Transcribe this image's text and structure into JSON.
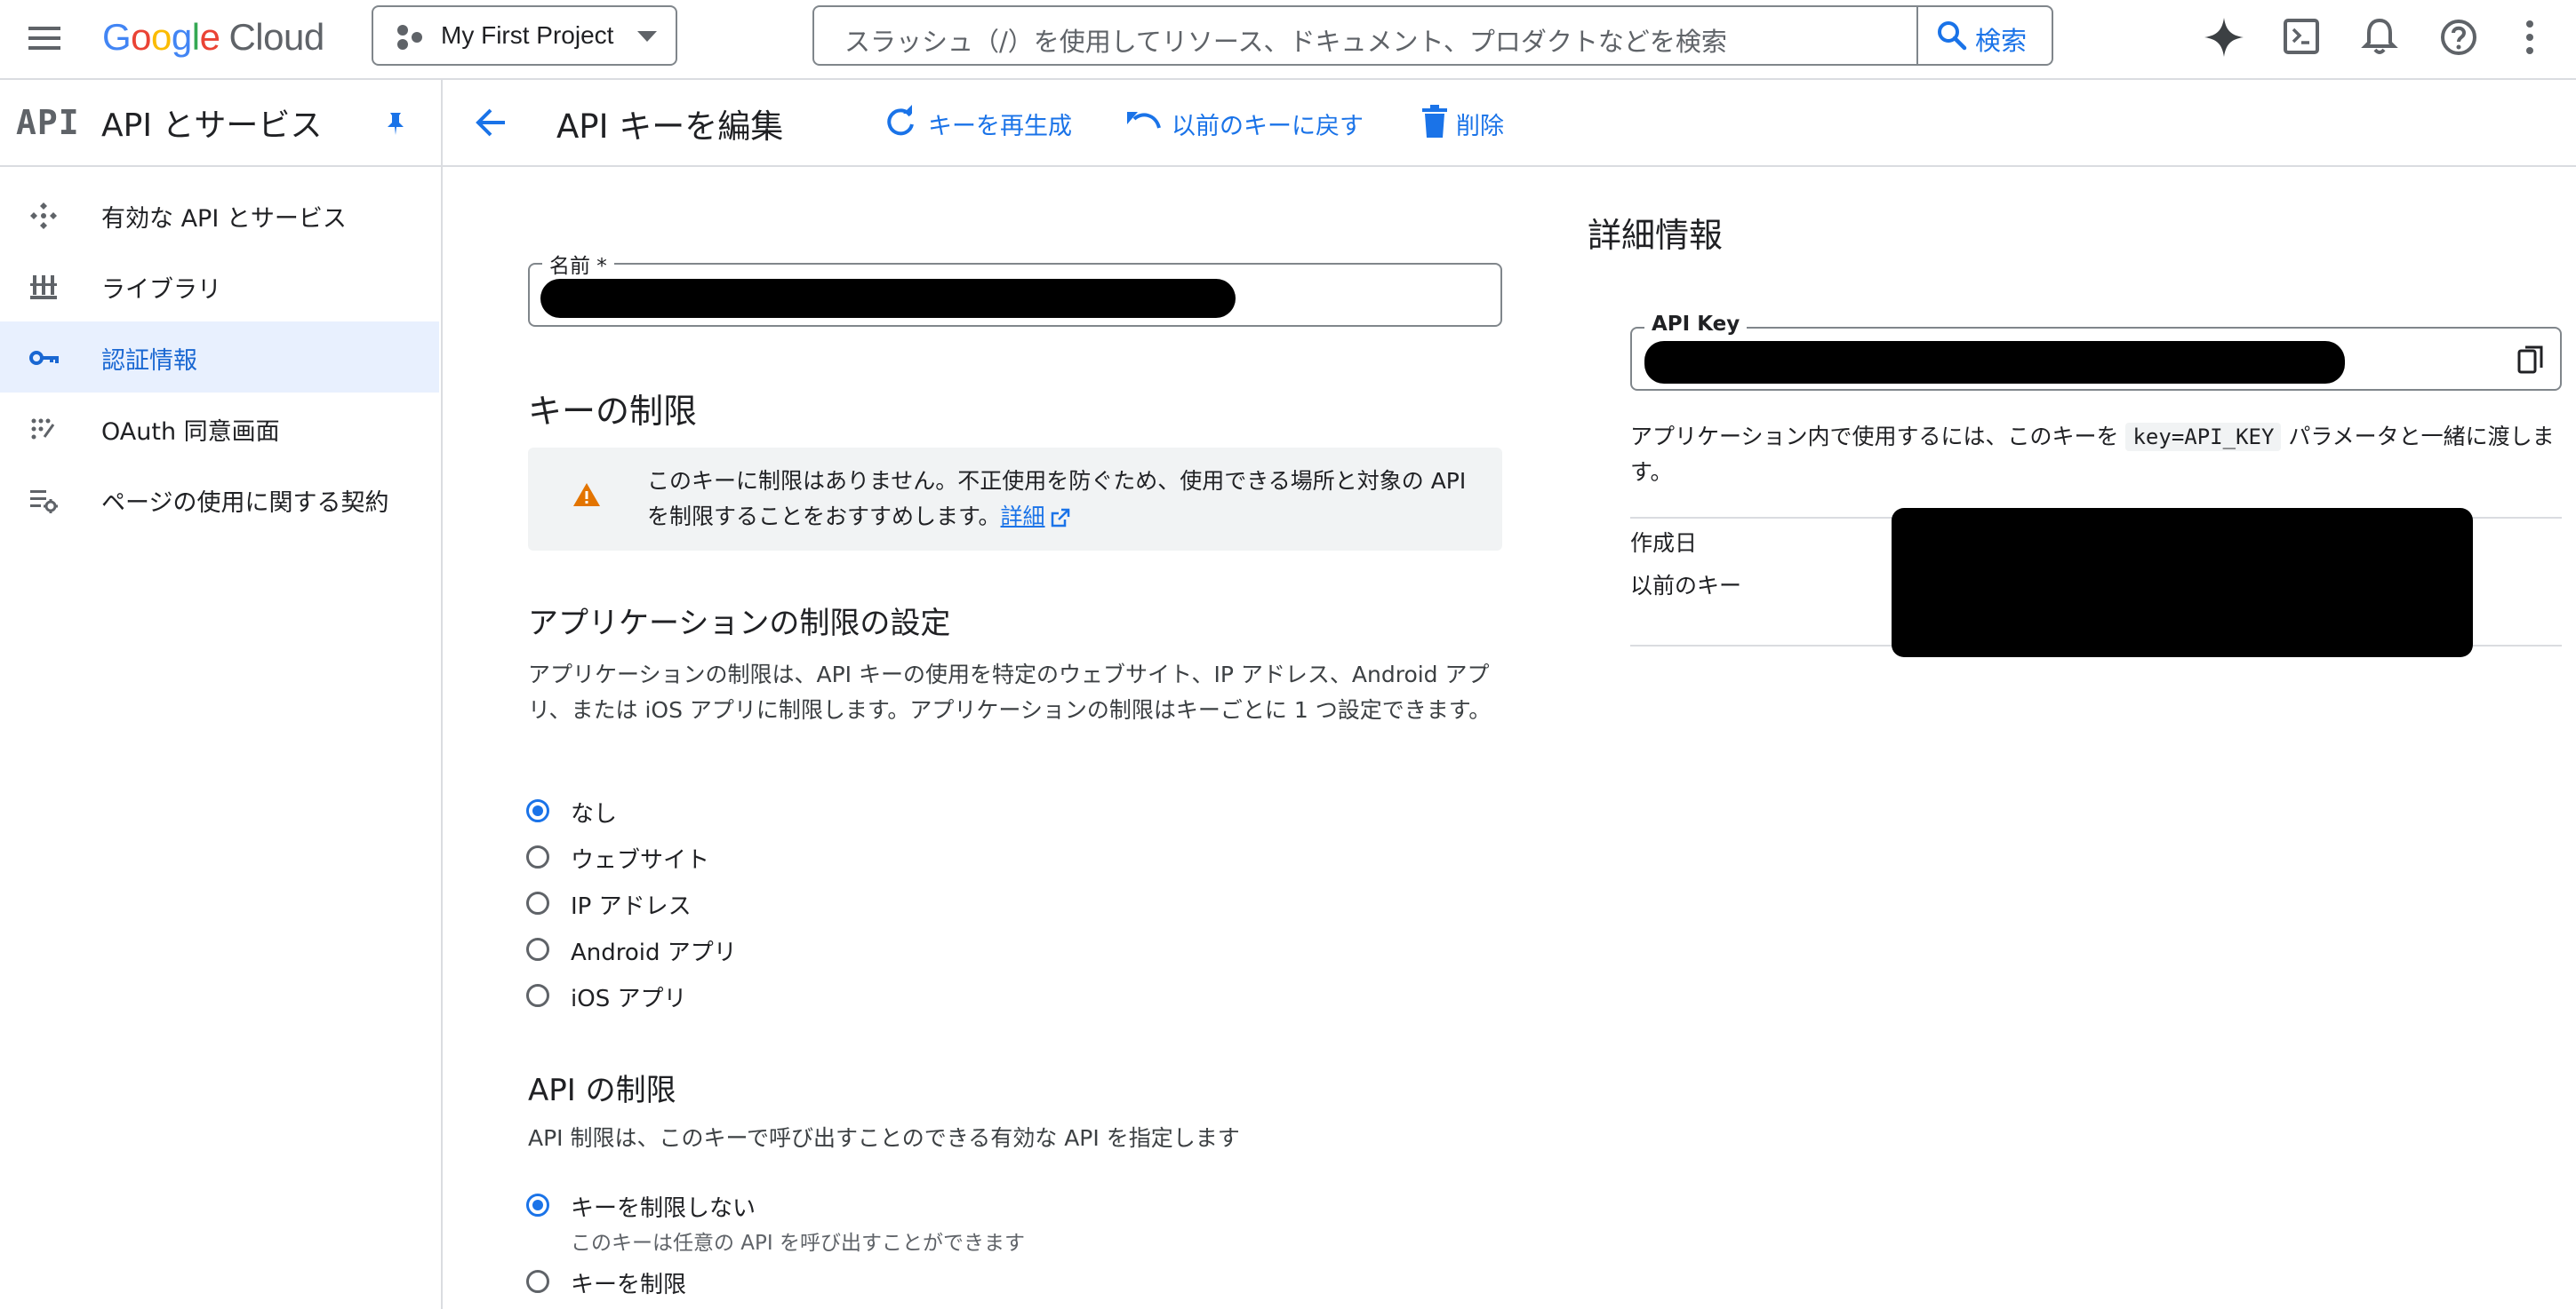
{
  "topbar": {
    "logo_google": [
      "G",
      "o",
      "o",
      "g",
      "l",
      "e"
    ],
    "logo_cloud": "Cloud",
    "project_name": "My First Project",
    "search_placeholder": "スラッシュ（/）を使用してリソース、ドキュメント、プロダクトなどを検索",
    "search_button": "検索",
    "icons": [
      "menu-icon",
      "gemini-sparkle-icon",
      "cloud-shell-icon",
      "notifications-icon",
      "help-icon",
      "more-vert-icon"
    ]
  },
  "sidebar": {
    "mark": "API",
    "title": "API とサービス",
    "items": [
      {
        "label": "有効な API とサービス",
        "icon": "enabled-apis-icon",
        "active": false
      },
      {
        "label": "ライブラリ",
        "icon": "library-icon",
        "active": false
      },
      {
        "label": "認証情報",
        "icon": "key-icon",
        "active": true
      },
      {
        "label": "OAuth 同意画面",
        "icon": "oauth-consent-icon",
        "active": false
      },
      {
        "label": "ページの使用に関する契約",
        "icon": "page-usage-icon",
        "active": false
      }
    ]
  },
  "header": {
    "title": "API キーを編集",
    "actions": {
      "regenerate": "キーを再生成",
      "revert": "以前のキーに戻す",
      "delete": "削除"
    }
  },
  "form": {
    "name_label": "名前 *",
    "key_restrictions_title": "キーの制限",
    "warning_text": "このキーに制限はありません。不正使用を防ぐため、使用できる場所と対象の API を制限することをおすすめします。",
    "warning_link": "詳細",
    "app_restrictions_title": "アプリケーションの制限の設定",
    "app_restrictions_desc": "アプリケーションの制限は、API キーの使用を特定のウェブサイト、IP アドレス、Android アプリ、または iOS アプリに制限します。アプリケーションの制限はキーごとに 1 つ設定できます。",
    "app_options": [
      {
        "label": "なし",
        "checked": true
      },
      {
        "label": "ウェブサイト",
        "checked": false
      },
      {
        "label": "IP アドレス",
        "checked": false
      },
      {
        "label": "Android アプリ",
        "checked": false
      },
      {
        "label": "iOS アプリ",
        "checked": false
      }
    ],
    "api_restrictions_title": "API の制限",
    "api_restrictions_desc": "API 制限は、このキーで呼び出すことのできる有効な API を指定します",
    "api_options": [
      {
        "label": "キーを制限しない",
        "sub": "このキーは任意の API を呼び出すことができます",
        "checked": true
      },
      {
        "label": "キーを制限",
        "sub": "",
        "checked": false
      }
    ]
  },
  "details": {
    "title": "詳細情報",
    "api_key_label": "API Key",
    "usage_prefix": "アプリケーション内で使用するには、このキーを",
    "usage_code": "key=API_KEY",
    "usage_suffix": "パラメータと一緒に渡します。",
    "created_label": "作成日",
    "previous_key_label": "以前のキー"
  },
  "colors": {
    "accent": "#1a73e8",
    "active_nav_bg": "#e8f0fe",
    "warning": "#e37400"
  }
}
